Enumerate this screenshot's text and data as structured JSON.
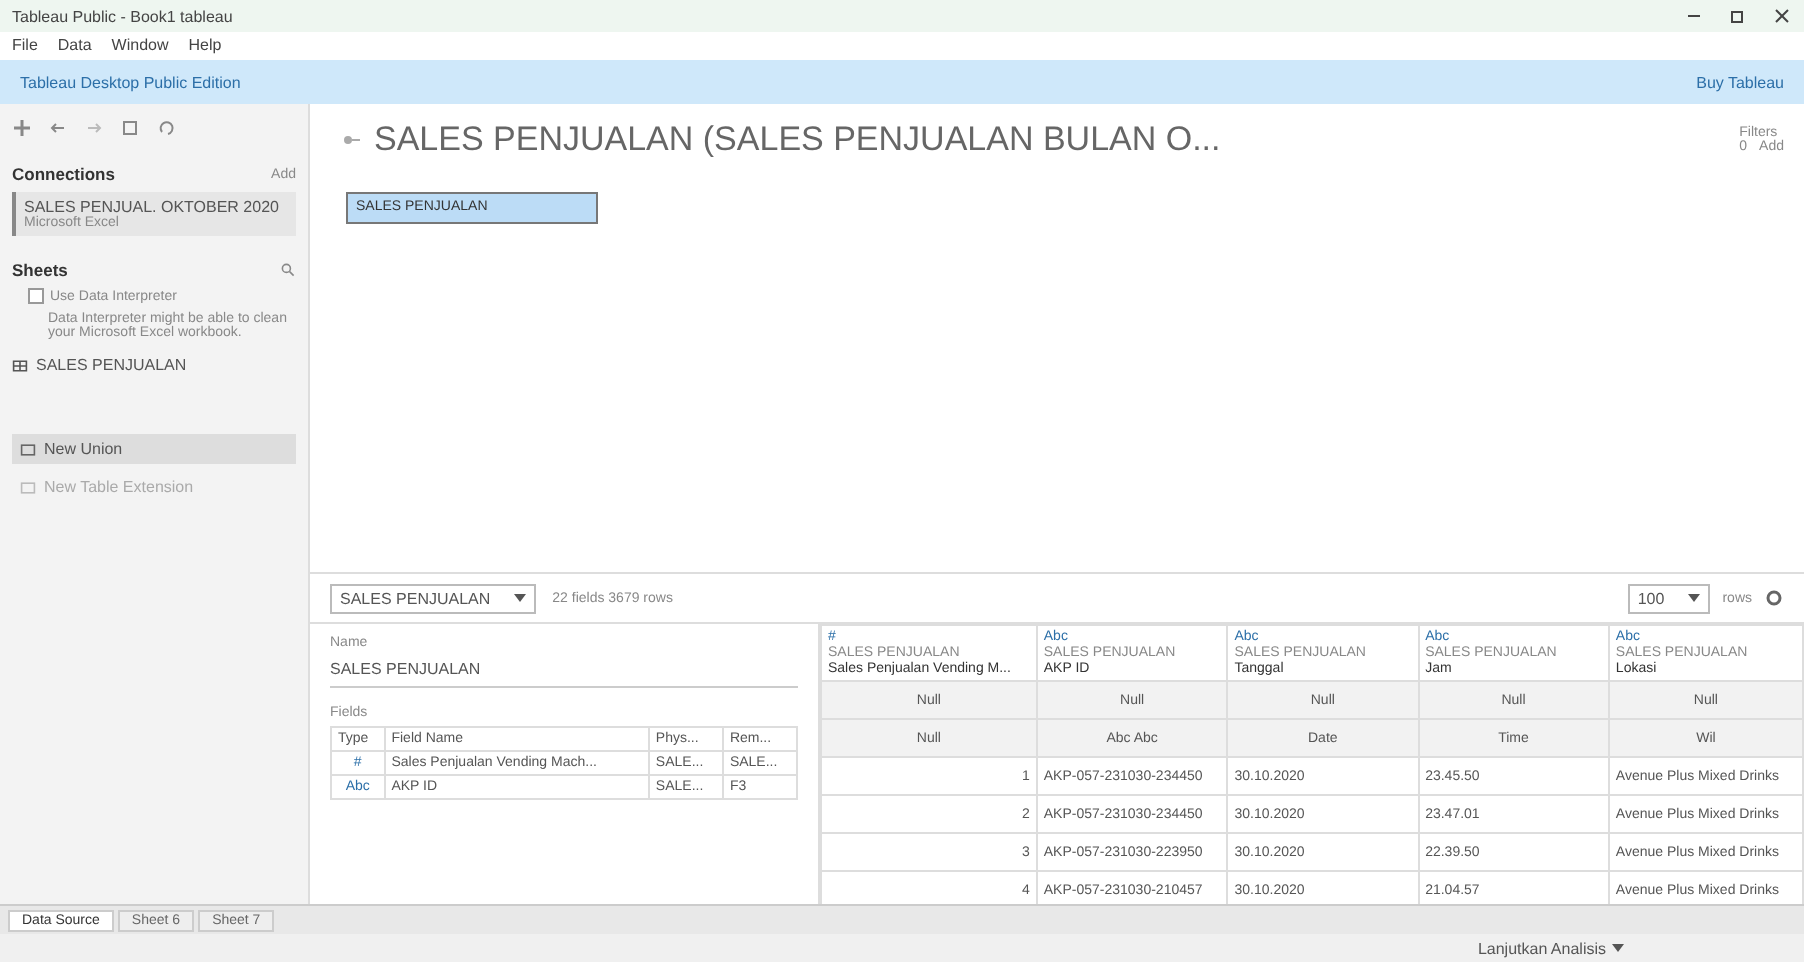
{
  "window": {
    "title": "Tableau Public - Book1 tableau"
  },
  "menu": [
    "File",
    "Data",
    "Window",
    "Help"
  ],
  "banner": {
    "text": "Tableau Desktop Public Edition",
    "link": "Buy Tableau"
  },
  "sidebar": {
    "connections_label": "Connections",
    "add": "Add",
    "connection": {
      "name": "SALES PENJUAL. OKTOBER 2020",
      "type": "Microsoft Excel"
    },
    "sheets_label": "Sheets",
    "interpreter": {
      "label": "Use Data Interpreter",
      "checked": false,
      "note": "Data Interpreter might be able to clean your Microsoft Excel workbook."
    },
    "sheets": [
      "SALES PENJUALAN"
    ],
    "actions": [
      {
        "label": "New Union",
        "disabled": false
      },
      {
        "label": "New Table Extension",
        "disabled": true
      }
    ]
  },
  "datasource": {
    "title": "SALES PENJUALAN (SALES PENJUALAN BULAN O...",
    "filters_label": "Filters",
    "filters_count": "0",
    "filters_add": "Add"
  },
  "canvas": {
    "tables": [
      "SALES PENJUALAN"
    ]
  },
  "toolbar": {
    "table_select": "SALES PENJUALAN",
    "summary": "22 fields 3679 rows",
    "rows_select": "100",
    "rows_label": "rows"
  },
  "details": {
    "name_label": "Name",
    "name": "SALES PENJUALAN",
    "fields_label": "Fields",
    "columns": [
      "Type",
      "Field Name",
      "Phys...",
      "Rem..."
    ],
    "rows": [
      [
        "#",
        "Sales Penjualan Vending Mach...",
        "SALE...",
        "SALE..."
      ],
      [
        "Abc",
        "AKP ID",
        "SALE...",
        "F3"
      ]
    ]
  },
  "grid": {
    "columns": [
      {
        "type": "#",
        "source": "SALES PENJUALAN",
        "name": "Sales Penjualan Vending M...",
        "kind": "number"
      },
      {
        "type": "Abc",
        "source": "SALES PENJUALAN",
        "name": "AKP ID",
        "kind": "text"
      },
      {
        "type": "Abc",
        "source": "SALES PENJUALAN",
        "name": "Tanggal",
        "kind": "text"
      },
      {
        "type": "Abc",
        "source": "SALES PENJUALAN",
        "name": "Jam",
        "kind": "text"
      },
      {
        "type": "Abc",
        "source": "SALES PENJUALAN",
        "name": "Lokasi",
        "kind": "text"
      }
    ],
    "header_rows": [
      [
        "Null",
        "Null",
        "Null",
        "Null",
        "Null"
      ],
      [
        "Null",
        "Abc Abc",
        "Date",
        "Time",
        "Wil"
      ]
    ],
    "rows": [
      [
        "1",
        "AKP-057-231030-234450",
        "30.10.2020",
        "23.45.50",
        "Avenue Plus Mixed Drinks"
      ],
      [
        "2",
        "AKP-057-231030-234450",
        "30.10.2020",
        "23.47.01",
        "Avenue Plus Mixed Drinks"
      ],
      [
        "3",
        "AKP-057-231030-223950",
        "30.10.2020",
        "22.39.50",
        "Avenue Plus Mixed Drinks"
      ],
      [
        "4",
        "AKP-057-231030-210457",
        "30.10.2020",
        "21.04.57",
        "Avenue Plus Mixed Drinks"
      ]
    ]
  },
  "tabs": [
    {
      "label": "Data Source",
      "selected": true
    },
    {
      "label": "Sheet 6",
      "selected": false
    },
    {
      "label": "Sheet 7",
      "selected": false
    }
  ],
  "status": {
    "user": "Lanjutkan Analisis"
  }
}
